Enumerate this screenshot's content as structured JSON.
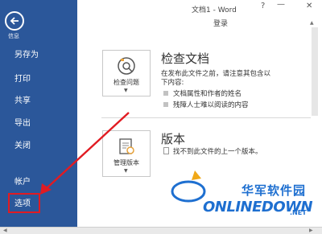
{
  "window": {
    "title": "文档1 - Word",
    "help": "?",
    "minimize": "—",
    "close": "✕",
    "login": "登录"
  },
  "sidebar": {
    "back_caption": "信息",
    "items": [
      {
        "label": "另存为"
      },
      {
        "label": "打印"
      },
      {
        "label": "共享"
      },
      {
        "label": "导出"
      },
      {
        "label": "关闭"
      },
      {
        "label": "帐户"
      },
      {
        "label": "选项"
      }
    ]
  },
  "inspect": {
    "button_label": "检查问题",
    "title": "检查文档",
    "desc_line1": "在发布此文件之前，请注意其包含以",
    "desc_line2": "下内容:",
    "bullets": [
      "文档属性和作者的姓名",
      "残障人士难以阅读的内容"
    ]
  },
  "versions": {
    "button_label": "管理版本",
    "title": "版本",
    "message": "找不到此文件的上一个版本。"
  },
  "watermark": {
    "cn": "华军软件园",
    "en": "ONLINEDOWN",
    "sub": ".NET"
  },
  "colors": {
    "sidebar": "#2b579a",
    "highlight": "#e11b22",
    "watermark": "#1e6fd0"
  },
  "icons": {
    "back": "back-arrow-icon",
    "inspect": "inspect-document-icon",
    "manage_versions": "manage-versions-icon"
  }
}
